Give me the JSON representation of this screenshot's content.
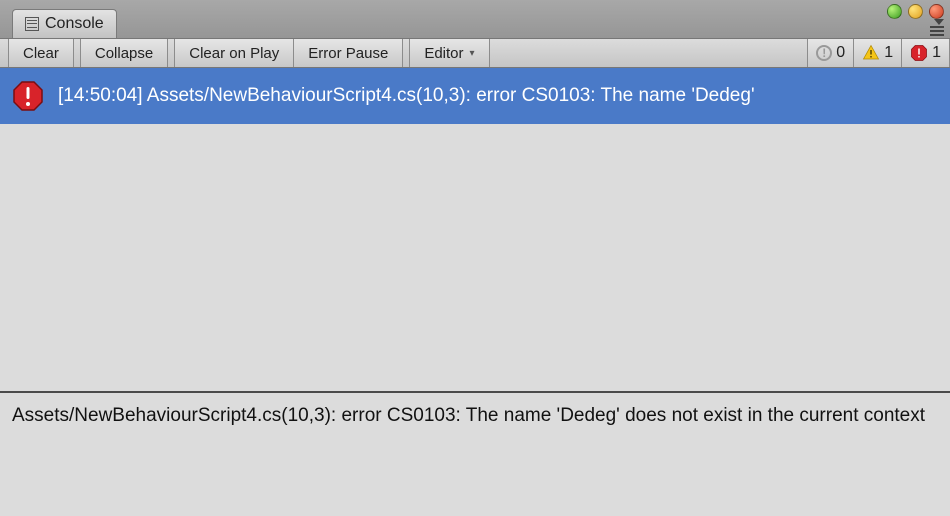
{
  "tab": {
    "title": "Console"
  },
  "toolbar": {
    "clear": "Clear",
    "collapse": "Collapse",
    "clear_on_play": "Clear on Play",
    "error_pause": "Error Pause",
    "editor": "Editor"
  },
  "counters": {
    "info": 0,
    "warn": 1,
    "error": 1
  },
  "log": {
    "timestamp": "[14:50:04]",
    "summary": "Assets/NewBehaviourScript4.cs(10,3): error CS0103: The name 'Dedeg' "
  },
  "detail": {
    "text": "Assets/NewBehaviourScript4.cs(10,3): error CS0103: The name 'Dedeg' does not exist in the current context"
  }
}
